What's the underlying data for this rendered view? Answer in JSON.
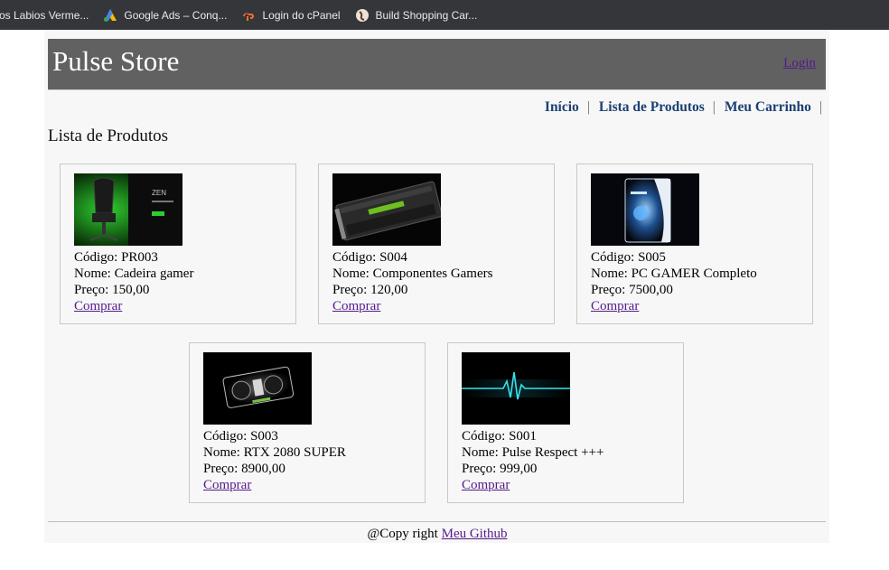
{
  "bookmarks": [
    {
      "label": "os Labios Verme...",
      "icon": "none"
    },
    {
      "label": "Google Ads – Conq...",
      "icon": "google-ads-icon"
    },
    {
      "label": "Login do cPanel",
      "icon": "cpanel-icon"
    },
    {
      "label": "Build Shopping Car...",
      "icon": "site-favicon-icon"
    }
  ],
  "header": {
    "brand": "Pulse Store",
    "login": "Login",
    "bg_color": "#616161"
  },
  "nav": {
    "items": [
      "Início",
      "Lista de Produtos",
      "Meu Carrinho"
    ],
    "separator": "|"
  },
  "section_title": "Lista de Produtos",
  "products": [
    {
      "code_label": "Código: PR003",
      "name_label": "Nome: Cadeira gamer",
      "price_label": "Preço: 150,00",
      "buy": "Comprar",
      "image": "gaming-chair-image"
    },
    {
      "code_label": "Código: S004",
      "name_label": "Nome: Componentes Gamers",
      "price_label": "Preço: 120,00",
      "buy": "Comprar",
      "image": "graphics-card-image"
    },
    {
      "code_label": "Código: S005",
      "name_label": "Nome: PC GAMER Completo",
      "price_label": "Preço: 7500,00",
      "buy": "Comprar",
      "image": "gaming-pc-image"
    },
    {
      "code_label": "Código: S003",
      "name_label": "Nome: RTX 2080 SUPER",
      "price_label": "Preço: 8900,00",
      "buy": "Comprar",
      "image": "rtx-card-image"
    },
    {
      "code_label": "Código: S001",
      "name_label": "Nome: Pulse Respect +++",
      "price_label": "Preço: 999,00",
      "buy": "Comprar",
      "image": "pulse-line-image"
    }
  ],
  "footer": {
    "text": "@Copy right",
    "link": "Meu Github"
  },
  "colors": {
    "link_visited": "#551a8b",
    "nav_link": "#1b3f73",
    "page_bg": "#f7f7f7"
  }
}
